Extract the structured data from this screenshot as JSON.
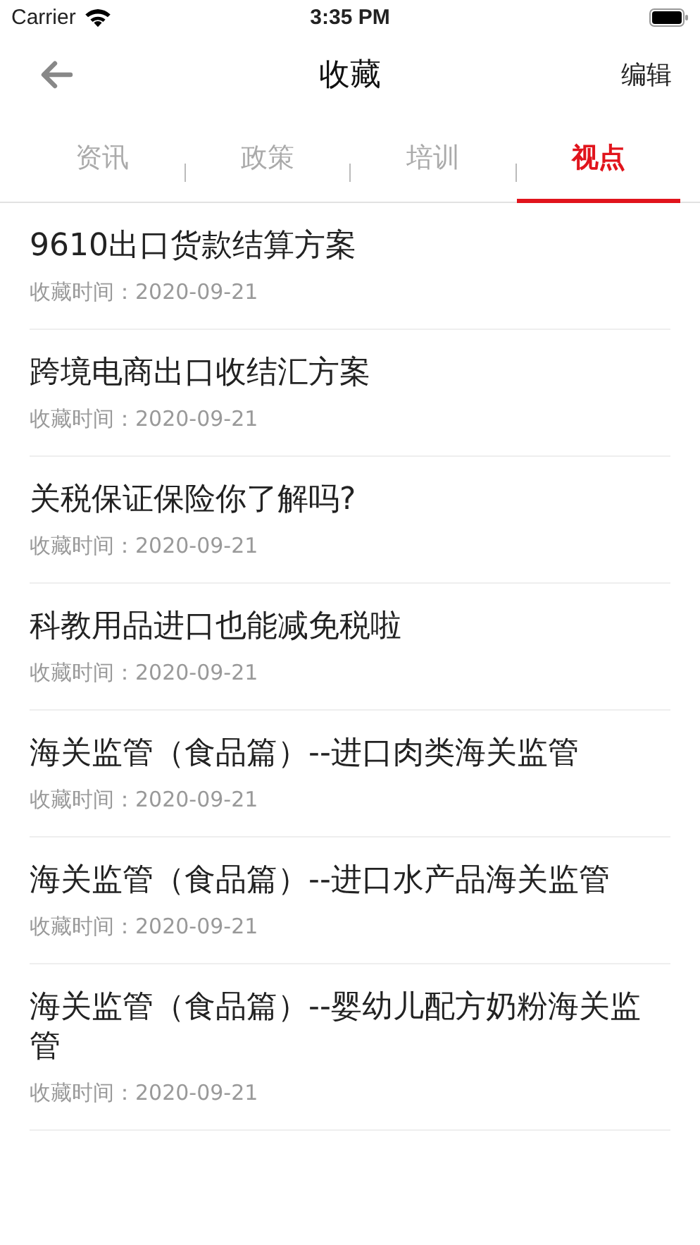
{
  "status_bar": {
    "carrier": "Carrier",
    "time": "3:35 PM"
  },
  "nav": {
    "title": "收藏",
    "action": "编辑"
  },
  "tabs": [
    {
      "label": "资讯",
      "selected": false
    },
    {
      "label": "政策",
      "selected": false
    },
    {
      "label": "培训",
      "selected": false
    },
    {
      "label": "视点",
      "selected": true
    }
  ],
  "items": [
    {
      "title": "9610出口货款结算方案",
      "meta": "收藏时间：2020-09-21"
    },
    {
      "title": "跨境电商出口收结汇方案",
      "meta": "收藏时间：2020-09-21"
    },
    {
      "title": "关税保证保险你了解吗?",
      "meta": "收藏时间：2020-09-21"
    },
    {
      "title": "科教用品进口也能减免税啦",
      "meta": "收藏时间：2020-09-21"
    },
    {
      "title": "海关监管（食品篇）--进口肉类海关监管",
      "meta": "收藏时间：2020-09-21"
    },
    {
      "title": "海关监管（食品篇）--进口水产品海关监管",
      "meta": "收藏时间：2020-09-21"
    },
    {
      "title": "海关监管（食品篇）--婴幼儿配方奶粉海关监管",
      "meta": "收藏时间：2020-09-21"
    }
  ]
}
